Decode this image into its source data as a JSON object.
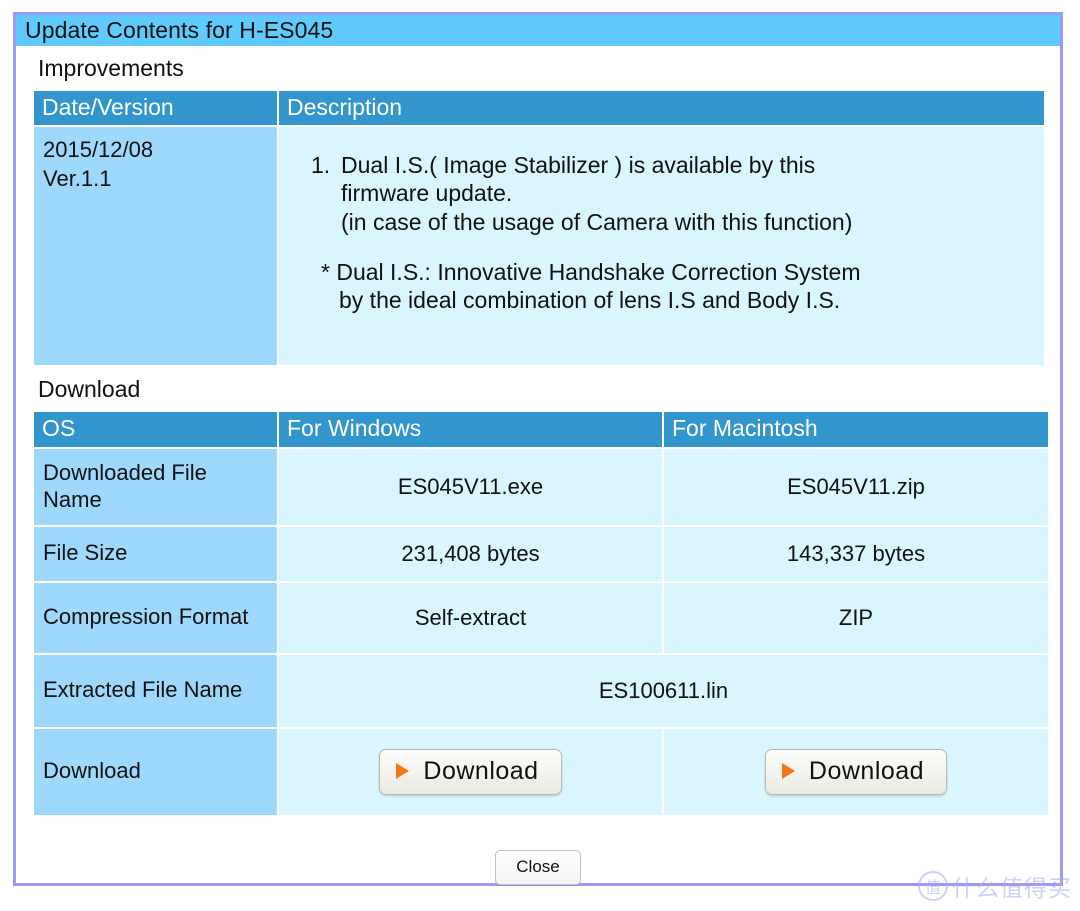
{
  "dialog": {
    "title": "Update Contents for H-ES045"
  },
  "improvements": {
    "heading": "Improvements",
    "columns": [
      "Date/Version",
      "Description"
    ],
    "rows": [
      {
        "date": "2015/12/08",
        "version": "Ver.1.1",
        "items": [
          {
            "number": "1.",
            "line1": "Dual I.S.( Image Stabilizer ) is available by this",
            "line2": "firmware update.",
            "line3": "(in case of the usage of Camera with this function)"
          }
        ],
        "note_line1": "* Dual I.S.:  Innovative Handshake Correction System",
        "note_line2": "by the ideal combination of lens I.S and Body I.S."
      }
    ]
  },
  "download": {
    "heading": "Download",
    "columns": [
      "OS",
      "For Windows",
      "For Macintosh"
    ],
    "rows": {
      "file_name": {
        "label": "Downloaded File Name",
        "windows": "ES045V11.exe",
        "macintosh": "ES045V11.zip"
      },
      "file_size": {
        "label": "File Size",
        "windows": "231,408 bytes",
        "macintosh": "143,337 bytes"
      },
      "compression": {
        "label": "Compression Format",
        "windows": "Self-extract",
        "macintosh": "ZIP"
      },
      "extracted": {
        "label": "Extracted File Name",
        "value": "ES100611.lin"
      },
      "download": {
        "label": "Download",
        "windows_button": "Download",
        "macintosh_button": "Download"
      }
    }
  },
  "footer": {
    "close_label": "Close"
  },
  "watermark": {
    "badge": "值",
    "text": "什么值得买"
  },
  "colors": {
    "frame_border": "#9b9bf5",
    "titlebar": "#5fcbfc",
    "table_header": "#3295cc",
    "label_cell": "#9fd8fd",
    "value_cell": "#d9f5fd",
    "accent_triangle": "#f4761a"
  }
}
